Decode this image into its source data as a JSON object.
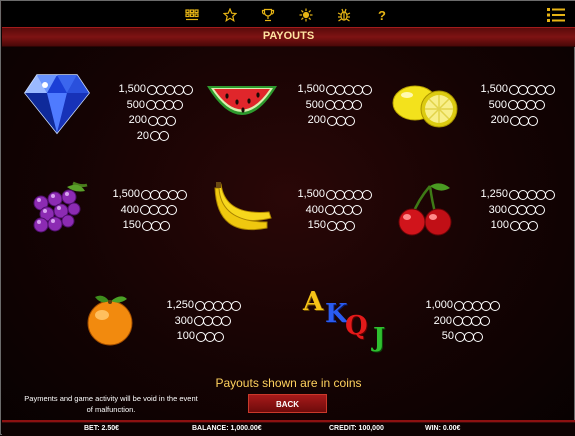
{
  "nav": {
    "icons": [
      "paytable-grid-icon",
      "star-icon",
      "trophy-icon",
      "sun-icon",
      "bug-icon",
      "help-icon"
    ],
    "help_glyph": "?",
    "menu_icon": "menu-list-icon",
    "accent": "#e7b515"
  },
  "title": "PAYOUTS",
  "symbols": {
    "diamond": {
      "icon": "diamond-icon",
      "pays": [
        "1,500",
        "500",
        "200",
        "20"
      ]
    },
    "watermelon": {
      "icon": "watermelon-icon",
      "pays": [
        "1,500",
        "500",
        "200"
      ]
    },
    "lemon": {
      "icon": "lemon-icon",
      "pays": [
        "1,500",
        "500",
        "200"
      ]
    },
    "grapes": {
      "icon": "grapes-icon",
      "pays": [
        "1,500",
        "400",
        "150"
      ]
    },
    "banana": {
      "icon": "banana-icon",
      "pays": [
        "1,500",
        "400",
        "150"
      ]
    },
    "cherry": {
      "icon": "cherry-icon",
      "pays": [
        "1,250",
        "300",
        "100"
      ]
    },
    "orange": {
      "icon": "orange-icon",
      "pays": [
        "1,250",
        "300",
        "100"
      ]
    },
    "akqj": {
      "icon": "akqj-letters-icon",
      "letters": [
        "A",
        "K",
        "Q",
        "J"
      ],
      "pays": [
        "1,000",
        "200",
        "50"
      ]
    }
  },
  "note": "Payouts shown are in coins",
  "disclaimer": "Payments and game activity will be void in the event of malfunction.",
  "back_label": "BACK",
  "status": {
    "bet": "BET: 2.50€",
    "balance": "BALANCE: 1,000.00€",
    "credit": "CREDIT: 100,000",
    "win": "WIN: 0.00€"
  }
}
